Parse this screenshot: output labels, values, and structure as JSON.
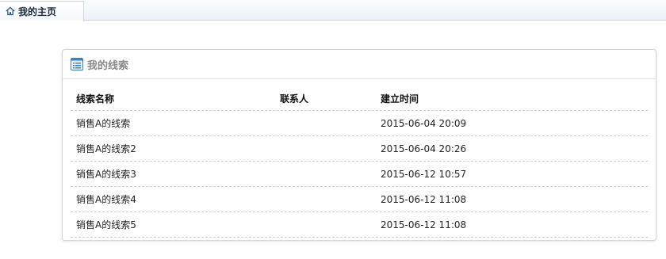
{
  "tabs": [
    {
      "label": "我的主页",
      "icon": "home-icon"
    }
  ],
  "panel": {
    "title": "我的线索",
    "icon": "list-icon",
    "columns": {
      "name": "线索名称",
      "contact": "联系人",
      "created": "建立时间"
    },
    "rows": [
      {
        "name": "销售A的线索",
        "contact": "",
        "created": "2015-06-04 20:09"
      },
      {
        "name": "销售A的线索2",
        "contact": "",
        "created": "2015-06-04 20:26"
      },
      {
        "name": "销售A的线索3",
        "contact": "",
        "created": "2015-06-12 10:57"
      },
      {
        "name": "销售A的线索4",
        "contact": "",
        "created": "2015-06-12 11:08"
      },
      {
        "name": "销售A的线索5",
        "contact": "",
        "created": "2015-06-12 11:08"
      }
    ]
  },
  "colors": {
    "tab_border": "#c9d7e3",
    "icon_blue": "#3b7fc4",
    "title_gray": "#8a8a8a"
  }
}
